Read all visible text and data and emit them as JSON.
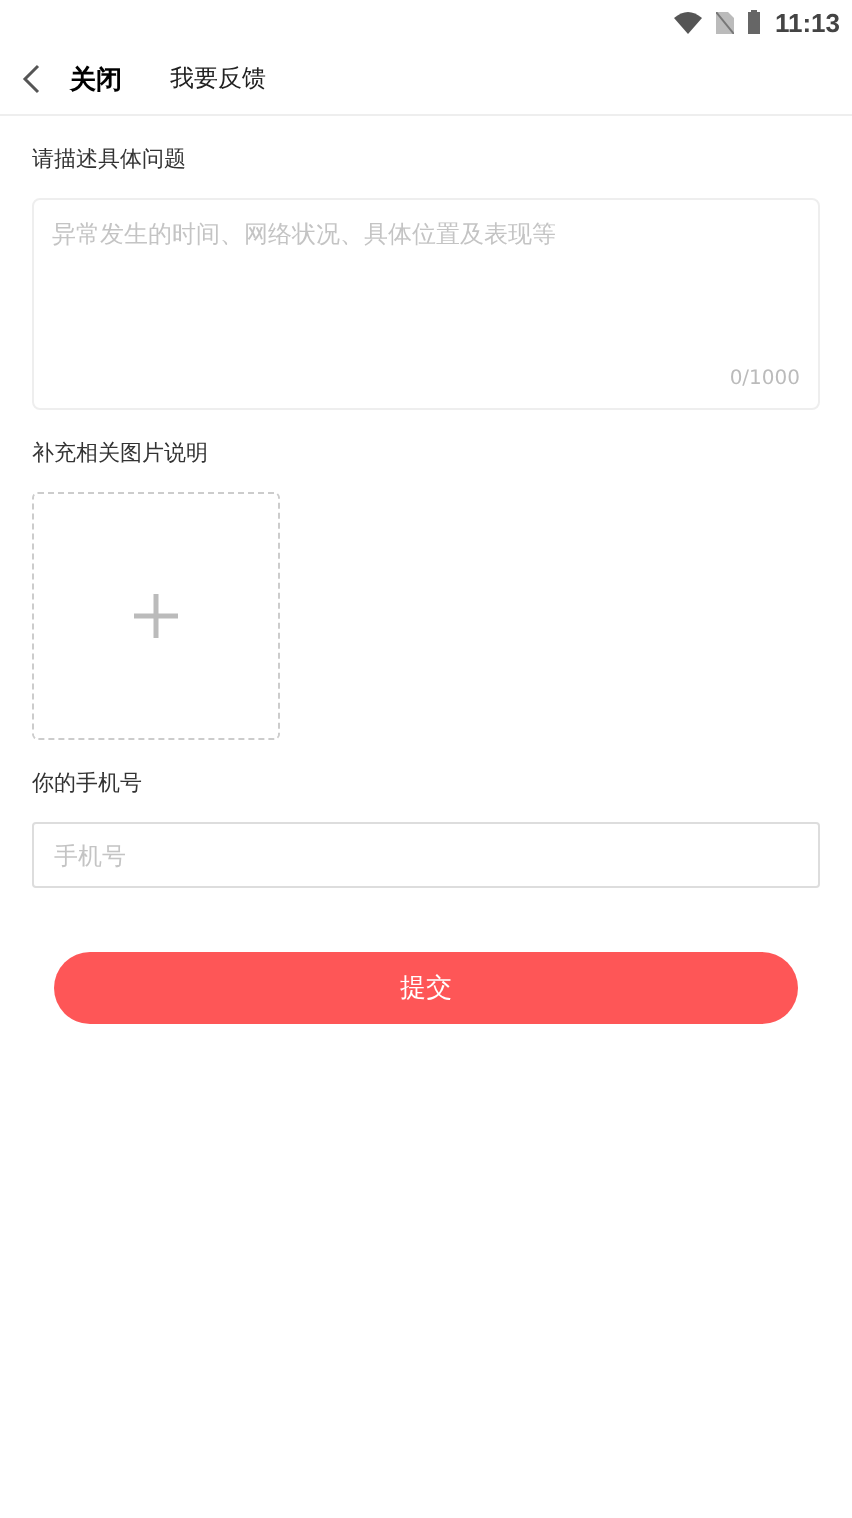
{
  "status_bar": {
    "time": "11:13"
  },
  "header": {
    "close": "关闭",
    "title": "我要反馈"
  },
  "description": {
    "label": "请描述具体问题",
    "placeholder": "异常发生的时间、网络状况、具体位置及表现等",
    "counter": "0/1000"
  },
  "images": {
    "label": "补充相关图片说明"
  },
  "phone": {
    "label": "你的手机号",
    "placeholder": "手机号"
  },
  "submit": "提交"
}
